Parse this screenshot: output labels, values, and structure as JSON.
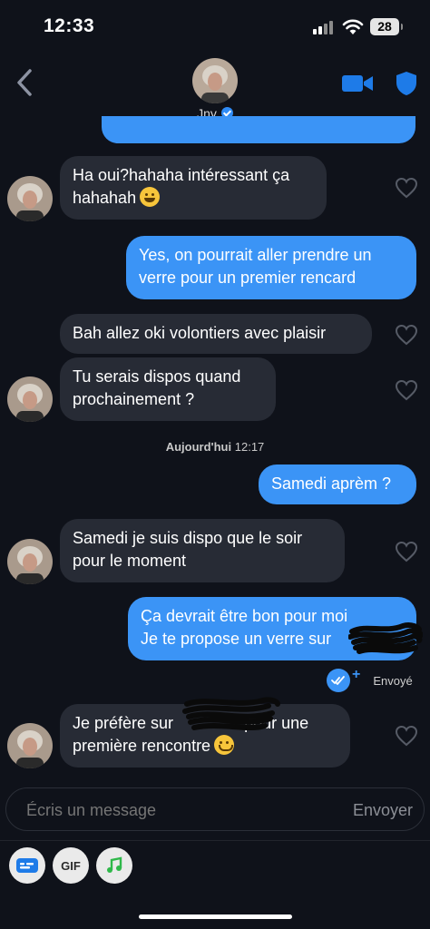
{
  "status_bar": {
    "time": "12:33",
    "battery": "28"
  },
  "header": {
    "contact_name": "Jny"
  },
  "messages": [
    {
      "from": "them",
      "text": "Ha oui?hahaha intéressant ça hahahah",
      "emoji": "grinning-face"
    },
    {
      "from": "me",
      "text": "Yes, on pourrait aller prendre un verre pour un premier rencard"
    },
    {
      "from": "them",
      "text": "Bah allez oki volontiers avec plaisir"
    },
    {
      "from": "them",
      "text": "Tu serais dispos quand prochainement ?"
    },
    {
      "from": "me",
      "text": "Samedi aprèm ?"
    },
    {
      "from": "them",
      "text": "Samedi je suis dispo que le soir pour le moment"
    },
    {
      "from": "me",
      "line1": "Ça devrait être bon pour moi",
      "line2": "Je te propose un verre sur"
    },
    {
      "from": "them",
      "part1": "Je préfère sur",
      "part2": "pour une",
      "line2": "première rencontre",
      "emoji": "smiling-face"
    }
  ],
  "date_separator": {
    "day": "Aujourd'hui",
    "time": "12:17"
  },
  "delivery_status": "Envoyé",
  "composer": {
    "placeholder": "Écris un message",
    "send_label": "Envoyer"
  },
  "toolbar": {
    "gif_label": "GIF"
  },
  "colors": {
    "background": "#0f121a",
    "incoming_bubble": "#272b35",
    "outgoing_bubble": "#3b94f6",
    "accent": "#1e7be8"
  }
}
